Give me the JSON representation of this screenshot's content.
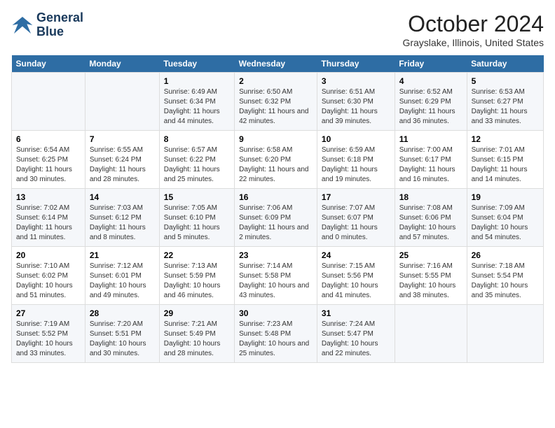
{
  "header": {
    "logo_line1": "General",
    "logo_line2": "Blue",
    "month_title": "October 2024",
    "location": "Grayslake, Illinois, United States"
  },
  "days_of_week": [
    "Sunday",
    "Monday",
    "Tuesday",
    "Wednesday",
    "Thursday",
    "Friday",
    "Saturday"
  ],
  "weeks": [
    [
      {
        "day": "",
        "detail": ""
      },
      {
        "day": "",
        "detail": ""
      },
      {
        "day": "1",
        "detail": "Sunrise: 6:49 AM\nSunset: 6:34 PM\nDaylight: 11 hours and 44 minutes."
      },
      {
        "day": "2",
        "detail": "Sunrise: 6:50 AM\nSunset: 6:32 PM\nDaylight: 11 hours and 42 minutes."
      },
      {
        "day": "3",
        "detail": "Sunrise: 6:51 AM\nSunset: 6:30 PM\nDaylight: 11 hours and 39 minutes."
      },
      {
        "day": "4",
        "detail": "Sunrise: 6:52 AM\nSunset: 6:29 PM\nDaylight: 11 hours and 36 minutes."
      },
      {
        "day": "5",
        "detail": "Sunrise: 6:53 AM\nSunset: 6:27 PM\nDaylight: 11 hours and 33 minutes."
      }
    ],
    [
      {
        "day": "6",
        "detail": "Sunrise: 6:54 AM\nSunset: 6:25 PM\nDaylight: 11 hours and 30 minutes."
      },
      {
        "day": "7",
        "detail": "Sunrise: 6:55 AM\nSunset: 6:24 PM\nDaylight: 11 hours and 28 minutes."
      },
      {
        "day": "8",
        "detail": "Sunrise: 6:57 AM\nSunset: 6:22 PM\nDaylight: 11 hours and 25 minutes."
      },
      {
        "day": "9",
        "detail": "Sunrise: 6:58 AM\nSunset: 6:20 PM\nDaylight: 11 hours and 22 minutes."
      },
      {
        "day": "10",
        "detail": "Sunrise: 6:59 AM\nSunset: 6:18 PM\nDaylight: 11 hours and 19 minutes."
      },
      {
        "day": "11",
        "detail": "Sunrise: 7:00 AM\nSunset: 6:17 PM\nDaylight: 11 hours and 16 minutes."
      },
      {
        "day": "12",
        "detail": "Sunrise: 7:01 AM\nSunset: 6:15 PM\nDaylight: 11 hours and 14 minutes."
      }
    ],
    [
      {
        "day": "13",
        "detail": "Sunrise: 7:02 AM\nSunset: 6:14 PM\nDaylight: 11 hours and 11 minutes."
      },
      {
        "day": "14",
        "detail": "Sunrise: 7:03 AM\nSunset: 6:12 PM\nDaylight: 11 hours and 8 minutes."
      },
      {
        "day": "15",
        "detail": "Sunrise: 7:05 AM\nSunset: 6:10 PM\nDaylight: 11 hours and 5 minutes."
      },
      {
        "day": "16",
        "detail": "Sunrise: 7:06 AM\nSunset: 6:09 PM\nDaylight: 11 hours and 2 minutes."
      },
      {
        "day": "17",
        "detail": "Sunrise: 7:07 AM\nSunset: 6:07 PM\nDaylight: 11 hours and 0 minutes."
      },
      {
        "day": "18",
        "detail": "Sunrise: 7:08 AM\nSunset: 6:06 PM\nDaylight: 10 hours and 57 minutes."
      },
      {
        "day": "19",
        "detail": "Sunrise: 7:09 AM\nSunset: 6:04 PM\nDaylight: 10 hours and 54 minutes."
      }
    ],
    [
      {
        "day": "20",
        "detail": "Sunrise: 7:10 AM\nSunset: 6:02 PM\nDaylight: 10 hours and 51 minutes."
      },
      {
        "day": "21",
        "detail": "Sunrise: 7:12 AM\nSunset: 6:01 PM\nDaylight: 10 hours and 49 minutes."
      },
      {
        "day": "22",
        "detail": "Sunrise: 7:13 AM\nSunset: 5:59 PM\nDaylight: 10 hours and 46 minutes."
      },
      {
        "day": "23",
        "detail": "Sunrise: 7:14 AM\nSunset: 5:58 PM\nDaylight: 10 hours and 43 minutes."
      },
      {
        "day": "24",
        "detail": "Sunrise: 7:15 AM\nSunset: 5:56 PM\nDaylight: 10 hours and 41 minutes."
      },
      {
        "day": "25",
        "detail": "Sunrise: 7:16 AM\nSunset: 5:55 PM\nDaylight: 10 hours and 38 minutes."
      },
      {
        "day": "26",
        "detail": "Sunrise: 7:18 AM\nSunset: 5:54 PM\nDaylight: 10 hours and 35 minutes."
      }
    ],
    [
      {
        "day": "27",
        "detail": "Sunrise: 7:19 AM\nSunset: 5:52 PM\nDaylight: 10 hours and 33 minutes."
      },
      {
        "day": "28",
        "detail": "Sunrise: 7:20 AM\nSunset: 5:51 PM\nDaylight: 10 hours and 30 minutes."
      },
      {
        "day": "29",
        "detail": "Sunrise: 7:21 AM\nSunset: 5:49 PM\nDaylight: 10 hours and 28 minutes."
      },
      {
        "day": "30",
        "detail": "Sunrise: 7:23 AM\nSunset: 5:48 PM\nDaylight: 10 hours and 25 minutes."
      },
      {
        "day": "31",
        "detail": "Sunrise: 7:24 AM\nSunset: 5:47 PM\nDaylight: 10 hours and 22 minutes."
      },
      {
        "day": "",
        "detail": ""
      },
      {
        "day": "",
        "detail": ""
      }
    ]
  ]
}
